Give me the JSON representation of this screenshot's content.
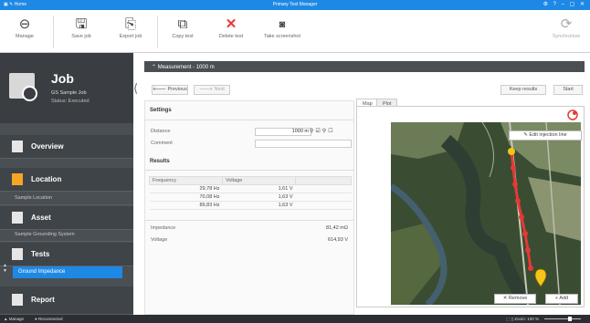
{
  "titlebar": {
    "app_title": "Primary Test Manager",
    "app_icons": "▣ ✎ Home",
    "window_controls": "⚙ ? – ▢ ✕"
  },
  "ribbon": {
    "manage": "Manage",
    "save_job": "Save job",
    "export_job": "Export job",
    "copy_test": "Copy test",
    "delete_test": "Delete test",
    "take_screenshot": "Take screenshot",
    "synchronize": "Synchronize"
  },
  "sidebar": {
    "job_title": "Job",
    "job_name": "GS Sample Job",
    "job_status": "Status: Executed",
    "overview": "Overview",
    "location": "Location",
    "location_sub": "Sample Location",
    "asset": "Asset",
    "asset_sub": "Sample Grounding System",
    "tests": "Tests",
    "active_test": "Ground Impedance",
    "report": "Report"
  },
  "measurement": {
    "header": "Measurement - 1000 m",
    "previous": "Previous",
    "next": "Next",
    "keep_results": "Keep results",
    "start": "Start"
  },
  "settings": {
    "title": "Settings",
    "distance_label": "Distance",
    "distance_value": "1000 m",
    "comment_label": "Comment",
    "comment_value": ""
  },
  "results": {
    "title": "Results",
    "columns": [
      "Frequency",
      "Voltage"
    ],
    "rows": [
      {
        "frequency": "29,78 Hz",
        "voltage": "1,61 V"
      },
      {
        "frequency": "70,08 Hz",
        "voltage": "1,63 V"
      },
      {
        "frequency": "89,83 Hz",
        "voltage": "1,63 V"
      }
    ],
    "impedance_label": "Impedance",
    "impedance_value": "81,42 mΩ",
    "voltage_label": "Voltage",
    "voltage_value": "614,93 V"
  },
  "map": {
    "tab_map": "Map",
    "tab_plot": "Plot",
    "edit_injection_line": "Edit injection line",
    "remove": "Remove",
    "add": "Add",
    "colors": {
      "forest": "#2f4a2c",
      "river": "#3b5566",
      "route": "#e53935",
      "marker": "#f5c518"
    }
  },
  "statusbar": {
    "left1": "▲ Manage",
    "left2": "● Reconnected",
    "right": "⬚ ▯ Zoom: 100 %"
  },
  "colors": {
    "accent": "#1e88e5",
    "sidebar": "#4a4f54"
  }
}
